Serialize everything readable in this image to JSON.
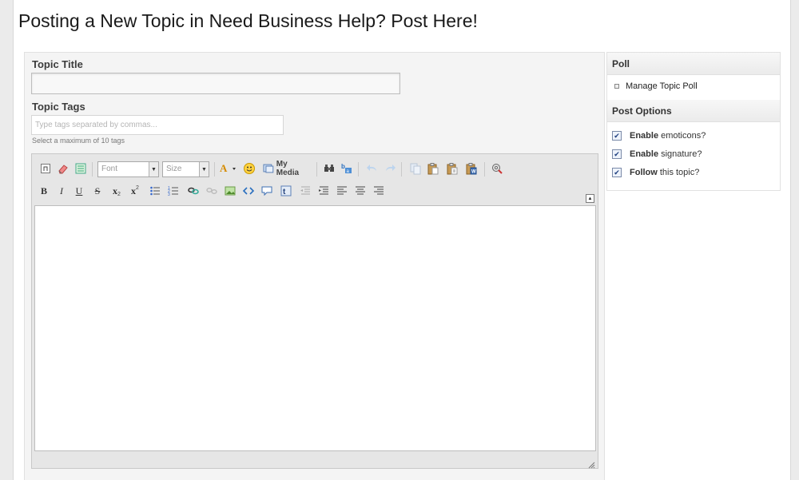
{
  "page": {
    "title": "Posting a New Topic in Need Business Help? Post Here!"
  },
  "form": {
    "topic_title_label": "Topic Title",
    "topic_title_value": "",
    "topic_tags_label": "Topic Tags",
    "tags_placeholder": "Type tags separated by commas...",
    "tags_hint": "Select a maximum of 10 tags"
  },
  "editor": {
    "font_select": "Font",
    "size_select": "Size",
    "my_media_label": "My Media",
    "bold": "B",
    "italic": "I",
    "underline": "U",
    "strike": "S",
    "subscript": "x",
    "superscript": "x",
    "content": ""
  },
  "sidebar": {
    "poll_heading": "Poll",
    "manage_poll_label": "Manage Topic Poll",
    "post_options_heading": "Post Options",
    "options": [
      {
        "bold": "Enable",
        "rest": "emoticons?",
        "checked": true
      },
      {
        "bold": "Enable",
        "rest": "signature?",
        "checked": true
      },
      {
        "bold": "Follow",
        "rest": "this topic?",
        "checked": true
      }
    ]
  },
  "colors": {
    "background": "#ebebeb",
    "panel": "#f4f4f4",
    "checkbox_check": "#1f3f80"
  }
}
